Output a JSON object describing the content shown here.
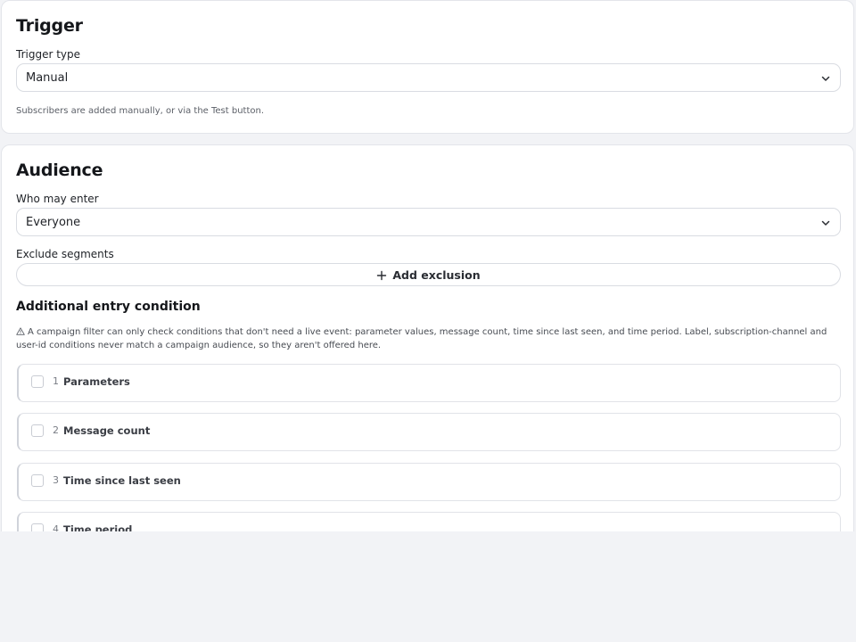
{
  "trigger": {
    "title": "Trigger",
    "type_label": "Trigger type",
    "type_value": "Manual",
    "helper": "Subscribers are added manually, or via the Test button."
  },
  "audience": {
    "title": "Audience",
    "who_label": "Who may enter",
    "who_value": "Everyone",
    "exclude_label": "Exclude segments",
    "add_exclusion": "Add exclusion",
    "entry_condition_heading": "Additional entry condition",
    "warning_text": "A campaign filter can only check conditions that don't need a live event: parameter values, message count, time since last seen, and time period. Label, subscription-channel and user-id conditions never match a campaign audience, so they aren't offered here.",
    "conditions": [
      {
        "num": "1",
        "label": "Parameters"
      },
      {
        "num": "2",
        "label": "Message count"
      },
      {
        "num": "3",
        "label": "Time since last seen"
      },
      {
        "num": "4",
        "label": "Time period"
      }
    ]
  },
  "icons": {
    "chevron": "chevron-down-icon",
    "plus": "plus-icon",
    "warning": "warning-triangle-icon"
  },
  "colors": {
    "page_background": "#f2f3f6",
    "card_background": "#ffffff",
    "border": "#d9dce2",
    "text": "#1b1d21"
  }
}
